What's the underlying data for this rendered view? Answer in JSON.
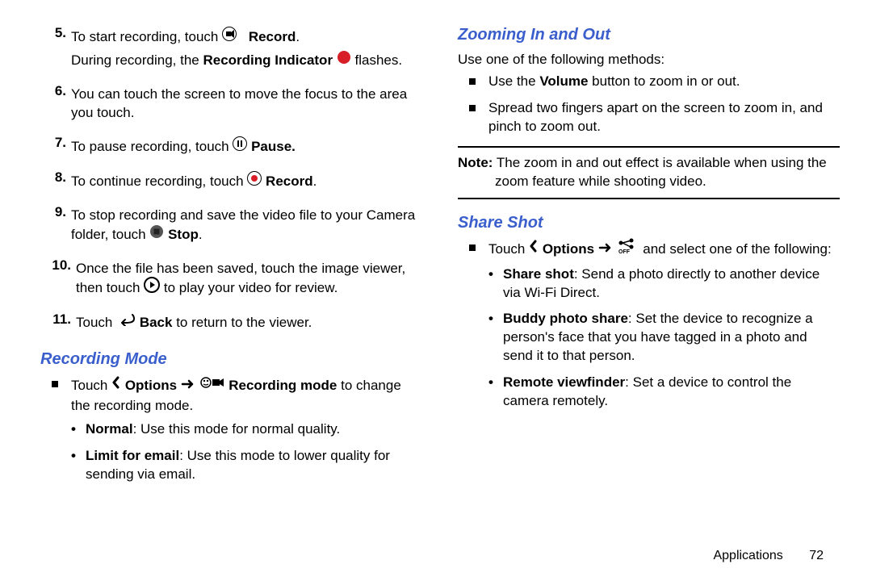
{
  "left": {
    "steps": [
      {
        "n": "5.",
        "lines": [
          {
            "type": "rich",
            "parts": [
              {
                "t": "To start recording, touch "
              },
              {
                "icon": "videocam"
              },
              {
                "t": " "
              },
              {
                "b": "Record"
              },
              {
                "t": "."
              }
            ]
          },
          {
            "type": "rich",
            "parts": [
              {
                "t": "During recording, the "
              },
              {
                "b": "Recording Indicator"
              },
              {
                "t": " "
              },
              {
                "icon": "reddot"
              },
              {
                "t": " flashes."
              }
            ]
          }
        ]
      },
      {
        "n": "6.",
        "lines": [
          {
            "type": "plain",
            "text": "You can touch the screen to move the focus to the area you touch."
          }
        ]
      },
      {
        "n": "7.",
        "lines": [
          {
            "type": "rich",
            "parts": [
              {
                "t": "To pause recording, touch "
              },
              {
                "icon": "pause"
              },
              {
                "t": " "
              },
              {
                "b": "Pause."
              }
            ]
          }
        ]
      },
      {
        "n": "8.",
        "lines": [
          {
            "type": "rich",
            "parts": [
              {
                "t": "To continue recording, touch "
              },
              {
                "icon": "recdot"
              },
              {
                "t": " "
              },
              {
                "b": "Record"
              },
              {
                "t": "."
              }
            ]
          }
        ]
      },
      {
        "n": "9.",
        "lines": [
          {
            "type": "rich",
            "parts": [
              {
                "t": "To stop recording and save the video file to your Camera folder, touch "
              },
              {
                "icon": "stop"
              },
              {
                "t": " "
              },
              {
                "b": "Stop"
              },
              {
                "t": "."
              }
            ]
          }
        ]
      },
      {
        "n": "10.",
        "lines": [
          {
            "type": "rich",
            "parts": [
              {
                "t": "Once the file has been saved, touch the image viewer, then touch "
              },
              {
                "icon": "playcircle"
              },
              {
                "t": " to play your video for review."
              }
            ]
          }
        ]
      },
      {
        "n": "11.",
        "lines": [
          {
            "type": "rich",
            "parts": [
              {
                "t": "Touch "
              },
              {
                "icon": "back"
              },
              {
                "t": " "
              },
              {
                "b": "Back"
              },
              {
                "t": " to return to the viewer."
              }
            ]
          }
        ]
      }
    ],
    "recmode_heading": "Recording Mode",
    "recmode_intro_parts": [
      {
        "t": "Touch "
      },
      {
        "icon": "chevron"
      },
      {
        "t": " "
      },
      {
        "b": "Options"
      },
      {
        "t": " "
      },
      {
        "icon": "arrow"
      },
      {
        "t": " "
      },
      {
        "icon": "recmode"
      },
      {
        "t": " "
      },
      {
        "b": "Recording mode"
      },
      {
        "t": " to change the recording mode."
      }
    ],
    "recmode_items": [
      {
        "b": "Normal",
        "rest": ": Use this mode for normal quality."
      },
      {
        "b": "Limit for email",
        "rest": ": Use this mode to lower quality for sending via email."
      }
    ]
  },
  "right": {
    "zoom_heading": "Zooming In and Out",
    "zoom_intro": "Use one of the following methods:",
    "zoom_items": [
      {
        "parts": [
          {
            "t": "Use the "
          },
          {
            "b": "Volume"
          },
          {
            "t": " button to zoom in or out."
          }
        ]
      },
      {
        "parts": [
          {
            "t": "Spread two fingers apart on the screen to zoom in, and pinch to zoom out."
          }
        ]
      }
    ],
    "note_label": "Note:",
    "note_first": " The zoom in and out effect is available when using the",
    "note_rest": "zoom feature while shooting video.",
    "share_heading": "Share Shot",
    "share_intro_parts": [
      {
        "t": "Touch "
      },
      {
        "icon": "chevron"
      },
      {
        "t": " "
      },
      {
        "b": "Options"
      },
      {
        "t": " "
      },
      {
        "icon": "arrow"
      },
      {
        "t": " "
      },
      {
        "icon": "shareoff"
      },
      {
        "t": " and select one of the following:"
      }
    ],
    "share_items": [
      {
        "b": "Share shot",
        "rest": ": Send a photo directly to another device via Wi-Fi Direct."
      },
      {
        "b": "Buddy photo share",
        "rest": ": Set the device to recognize a person's face that you have tagged in a photo and send it to that person."
      },
      {
        "b": "Remote viewfinder",
        "rest": ": Set a device to control the camera remotely."
      }
    ]
  },
  "footer": {
    "chapter": "Applications",
    "page": "72"
  }
}
